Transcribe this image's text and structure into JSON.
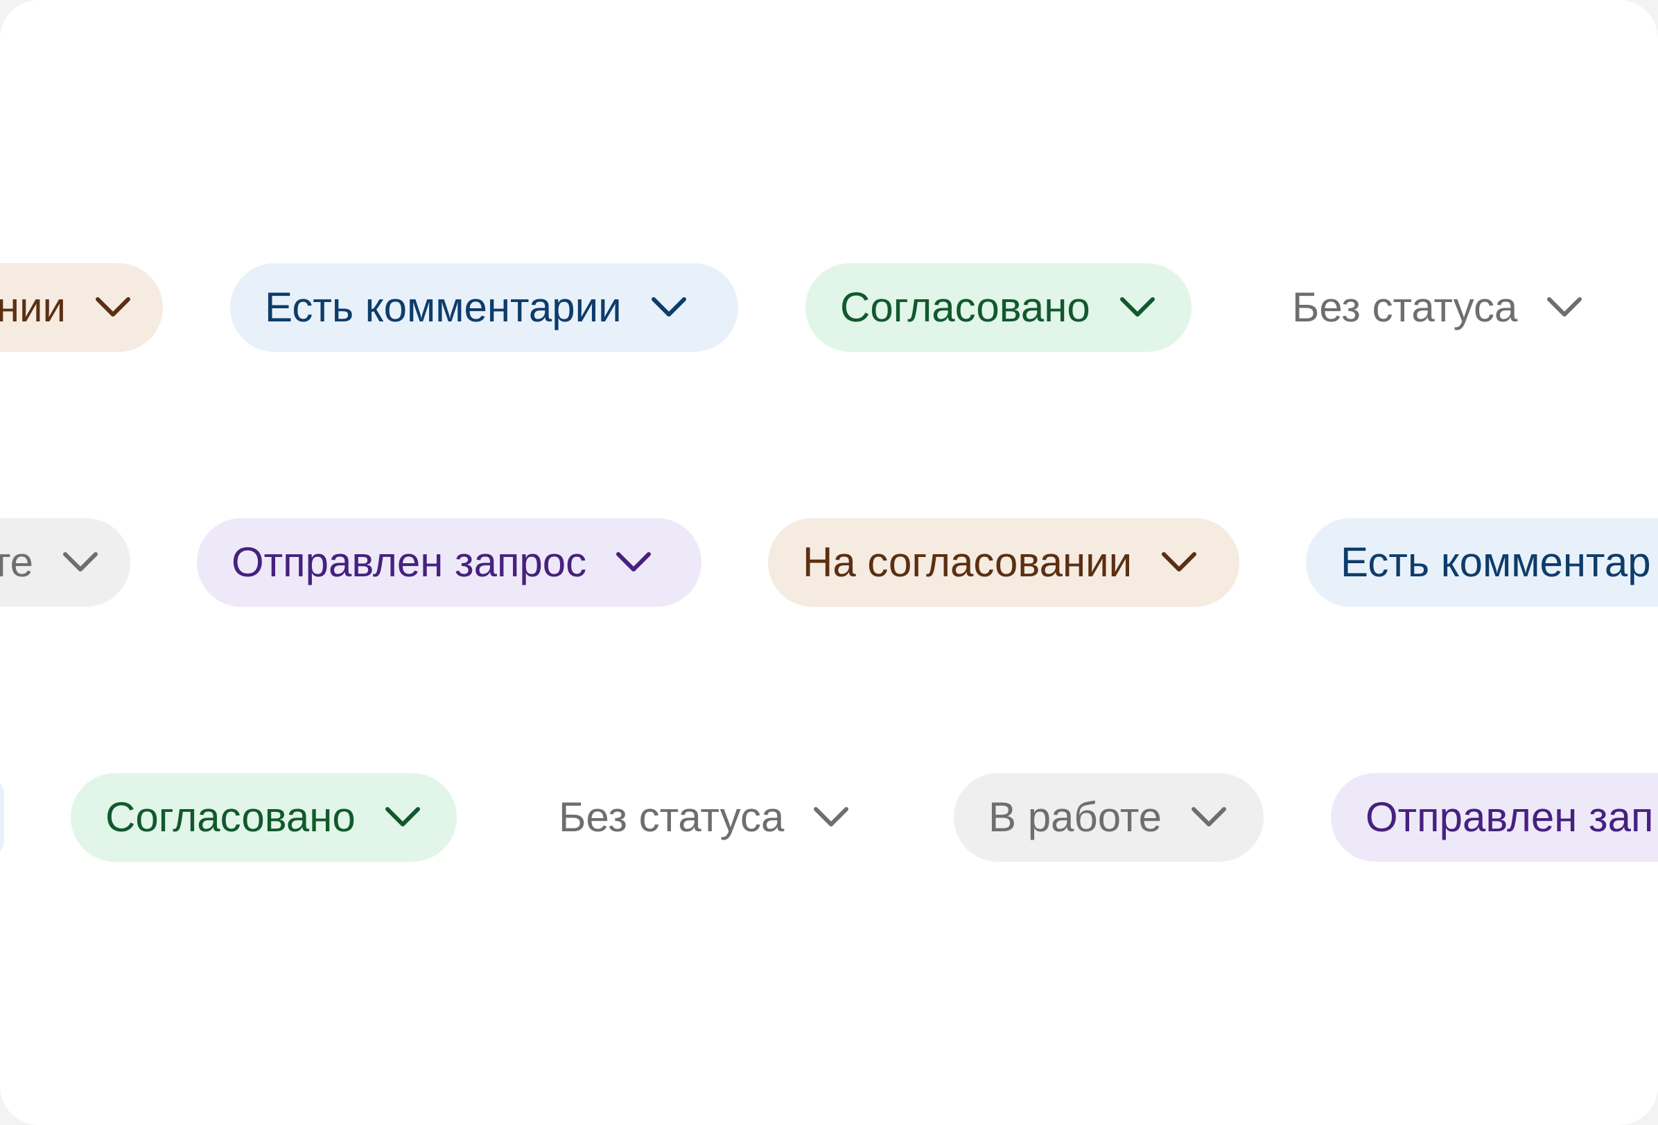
{
  "rows": [
    {
      "chips": [
        {
          "label": "нии",
          "status": "approval",
          "icon": "chevron-down-icon"
        },
        {
          "label": "Есть комментарии",
          "status": "comments",
          "icon": "chevron-down-icon"
        },
        {
          "label": "Согласовано",
          "status": "approved",
          "icon": "chevron-down-icon"
        },
        {
          "label": "Без статуса",
          "status": "nostatus",
          "icon": "chevron-down-icon"
        }
      ]
    },
    {
      "chips": [
        {
          "label": "те",
          "status": "inwork",
          "icon": "chevron-down-icon"
        },
        {
          "label": "Отправлен запрос",
          "status": "request",
          "icon": "chevron-down-icon"
        },
        {
          "label": "На согласовании",
          "status": "approval",
          "icon": "chevron-down-icon"
        },
        {
          "label": "Есть комментар",
          "status": "comments",
          "icon": "chevron-down-icon"
        }
      ]
    },
    {
      "chips": [
        {
          "label": "Согласовано",
          "status": "approved",
          "icon": "chevron-down-icon"
        },
        {
          "label": "Без статуса",
          "status": "nostatus",
          "icon": "chevron-down-icon"
        },
        {
          "label": "В работе",
          "status": "inwork",
          "icon": "chevron-down-icon"
        },
        {
          "label": "Отправлен зап",
          "status": "request",
          "icon": "chevron-down-icon"
        }
      ]
    }
  ],
  "colors": {
    "approval_bg": "#f5ebe1",
    "approval_text": "#5b2f12",
    "comments_bg": "#e8f1fa",
    "comments_text": "#0e3c6b",
    "approved_bg": "#e2f5e9",
    "approved_text": "#11592c",
    "nostatus_text": "#6e6e6e",
    "inwork_bg": "#efefef",
    "inwork_text": "#6e6e6e",
    "request_bg": "#eee9f8",
    "request_text": "#46217f"
  }
}
